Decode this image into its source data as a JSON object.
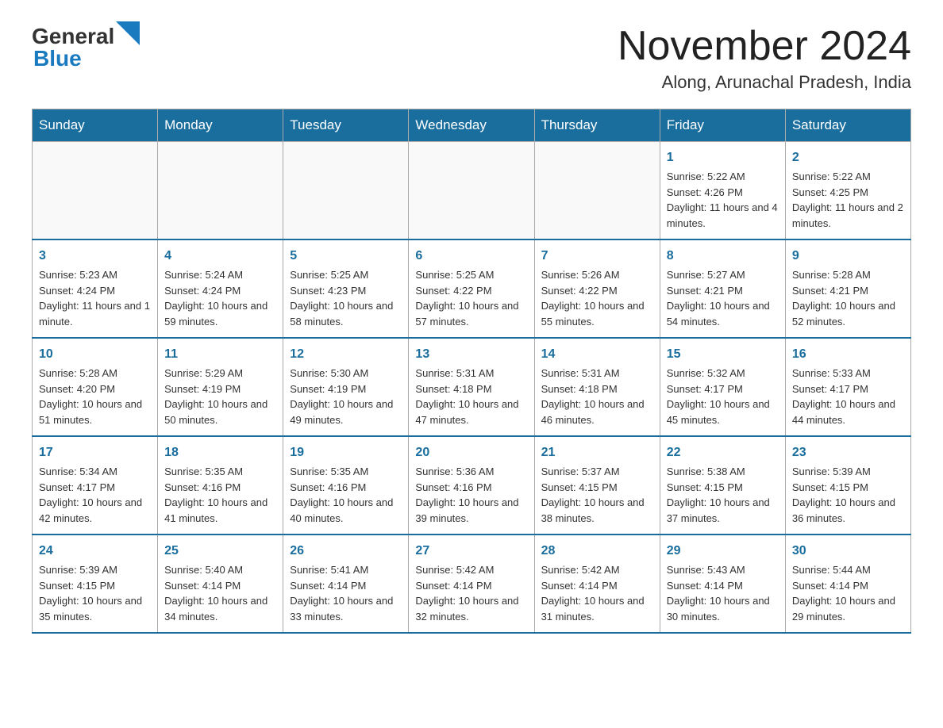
{
  "header": {
    "logo_general": "General",
    "logo_blue": "Blue",
    "month_title": "November 2024",
    "location": "Along, Arunachal Pradesh, India"
  },
  "weekdays": [
    "Sunday",
    "Monday",
    "Tuesday",
    "Wednesday",
    "Thursday",
    "Friday",
    "Saturday"
  ],
  "weeks": [
    [
      {
        "day": "",
        "info": ""
      },
      {
        "day": "",
        "info": ""
      },
      {
        "day": "",
        "info": ""
      },
      {
        "day": "",
        "info": ""
      },
      {
        "day": "",
        "info": ""
      },
      {
        "day": "1",
        "info": "Sunrise: 5:22 AM\nSunset: 4:26 PM\nDaylight: 11 hours and 4 minutes."
      },
      {
        "day": "2",
        "info": "Sunrise: 5:22 AM\nSunset: 4:25 PM\nDaylight: 11 hours and 2 minutes."
      }
    ],
    [
      {
        "day": "3",
        "info": "Sunrise: 5:23 AM\nSunset: 4:24 PM\nDaylight: 11 hours and 1 minute."
      },
      {
        "day": "4",
        "info": "Sunrise: 5:24 AM\nSunset: 4:24 PM\nDaylight: 10 hours and 59 minutes."
      },
      {
        "day": "5",
        "info": "Sunrise: 5:25 AM\nSunset: 4:23 PM\nDaylight: 10 hours and 58 minutes."
      },
      {
        "day": "6",
        "info": "Sunrise: 5:25 AM\nSunset: 4:22 PM\nDaylight: 10 hours and 57 minutes."
      },
      {
        "day": "7",
        "info": "Sunrise: 5:26 AM\nSunset: 4:22 PM\nDaylight: 10 hours and 55 minutes."
      },
      {
        "day": "8",
        "info": "Sunrise: 5:27 AM\nSunset: 4:21 PM\nDaylight: 10 hours and 54 minutes."
      },
      {
        "day": "9",
        "info": "Sunrise: 5:28 AM\nSunset: 4:21 PM\nDaylight: 10 hours and 52 minutes."
      }
    ],
    [
      {
        "day": "10",
        "info": "Sunrise: 5:28 AM\nSunset: 4:20 PM\nDaylight: 10 hours and 51 minutes."
      },
      {
        "day": "11",
        "info": "Sunrise: 5:29 AM\nSunset: 4:19 PM\nDaylight: 10 hours and 50 minutes."
      },
      {
        "day": "12",
        "info": "Sunrise: 5:30 AM\nSunset: 4:19 PM\nDaylight: 10 hours and 49 minutes."
      },
      {
        "day": "13",
        "info": "Sunrise: 5:31 AM\nSunset: 4:18 PM\nDaylight: 10 hours and 47 minutes."
      },
      {
        "day": "14",
        "info": "Sunrise: 5:31 AM\nSunset: 4:18 PM\nDaylight: 10 hours and 46 minutes."
      },
      {
        "day": "15",
        "info": "Sunrise: 5:32 AM\nSunset: 4:17 PM\nDaylight: 10 hours and 45 minutes."
      },
      {
        "day": "16",
        "info": "Sunrise: 5:33 AM\nSunset: 4:17 PM\nDaylight: 10 hours and 44 minutes."
      }
    ],
    [
      {
        "day": "17",
        "info": "Sunrise: 5:34 AM\nSunset: 4:17 PM\nDaylight: 10 hours and 42 minutes."
      },
      {
        "day": "18",
        "info": "Sunrise: 5:35 AM\nSunset: 4:16 PM\nDaylight: 10 hours and 41 minutes."
      },
      {
        "day": "19",
        "info": "Sunrise: 5:35 AM\nSunset: 4:16 PM\nDaylight: 10 hours and 40 minutes."
      },
      {
        "day": "20",
        "info": "Sunrise: 5:36 AM\nSunset: 4:16 PM\nDaylight: 10 hours and 39 minutes."
      },
      {
        "day": "21",
        "info": "Sunrise: 5:37 AM\nSunset: 4:15 PM\nDaylight: 10 hours and 38 minutes."
      },
      {
        "day": "22",
        "info": "Sunrise: 5:38 AM\nSunset: 4:15 PM\nDaylight: 10 hours and 37 minutes."
      },
      {
        "day": "23",
        "info": "Sunrise: 5:39 AM\nSunset: 4:15 PM\nDaylight: 10 hours and 36 minutes."
      }
    ],
    [
      {
        "day": "24",
        "info": "Sunrise: 5:39 AM\nSunset: 4:15 PM\nDaylight: 10 hours and 35 minutes."
      },
      {
        "day": "25",
        "info": "Sunrise: 5:40 AM\nSunset: 4:14 PM\nDaylight: 10 hours and 34 minutes."
      },
      {
        "day": "26",
        "info": "Sunrise: 5:41 AM\nSunset: 4:14 PM\nDaylight: 10 hours and 33 minutes."
      },
      {
        "day": "27",
        "info": "Sunrise: 5:42 AM\nSunset: 4:14 PM\nDaylight: 10 hours and 32 minutes."
      },
      {
        "day": "28",
        "info": "Sunrise: 5:42 AM\nSunset: 4:14 PM\nDaylight: 10 hours and 31 minutes."
      },
      {
        "day": "29",
        "info": "Sunrise: 5:43 AM\nSunset: 4:14 PM\nDaylight: 10 hours and 30 minutes."
      },
      {
        "day": "30",
        "info": "Sunrise: 5:44 AM\nSunset: 4:14 PM\nDaylight: 10 hours and 29 minutes."
      }
    ]
  ]
}
